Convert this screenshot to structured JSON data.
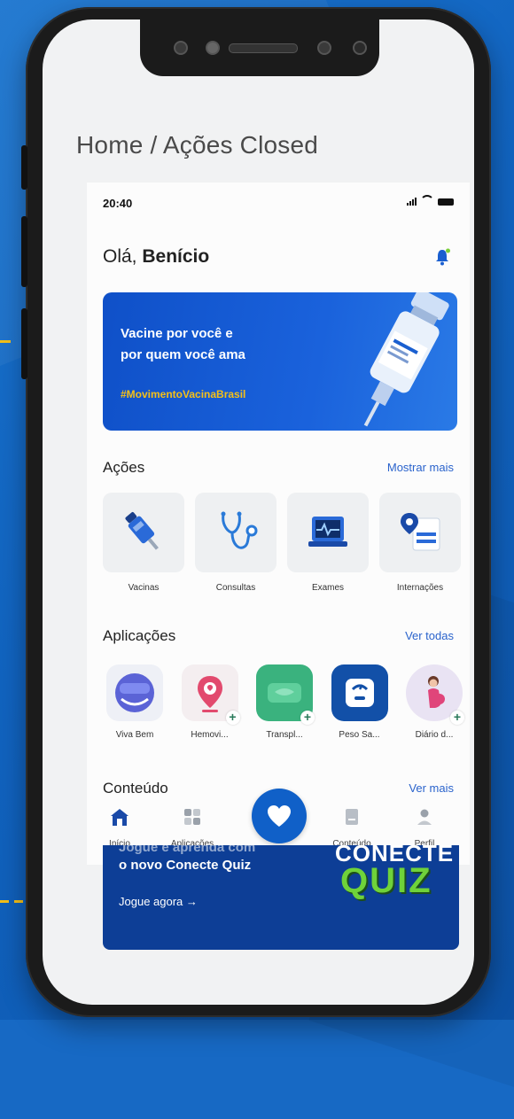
{
  "page_title": "Home / Ações Closed",
  "status": {
    "time": "20:40"
  },
  "greeting": {
    "prefix": "Olá, ",
    "name": "Benício"
  },
  "banner": {
    "line1": "Vacine por você e",
    "line2": "por quem você ama",
    "hashtag": "#MovimentoVacinaBrasil"
  },
  "acoes": {
    "title": "Ações",
    "more": "Mostrar mais",
    "items": [
      {
        "label": "Vacinas",
        "icon": "syringe-icon"
      },
      {
        "label": "Consultas",
        "icon": "stethoscope-icon"
      },
      {
        "label": "Exames",
        "icon": "monitor-icon"
      },
      {
        "label": "Internações",
        "icon": "hospital-card-icon"
      }
    ]
  },
  "aplicacoes": {
    "title": "Aplicações",
    "more": "Ver todas",
    "items": [
      {
        "label": "Viva Bem",
        "icon": "viva-bem-icon"
      },
      {
        "label": "Hemovi...",
        "icon": "blood-drop-pin-icon"
      },
      {
        "label": "Transpl...",
        "icon": "transplant-icon"
      },
      {
        "label": "Peso Sa...",
        "icon": "scale-icon"
      },
      {
        "label": "Diário d...",
        "icon": "pregnant-woman-icon"
      }
    ]
  },
  "conteudo": {
    "title": "Conteúdo",
    "more": "Ver mais"
  },
  "tabbar": {
    "inicio": "Início",
    "aplicacoes": "Aplicações",
    "conteudo": "Conteúdo",
    "perfil": "Perfil"
  },
  "quiz": {
    "line0": "Jogue e aprenda com",
    "line1": "o novo Conecte Quiz",
    "cta": "Jogue agora →",
    "brand_top": "CONECTE",
    "brand_bottom": "QUIZ"
  },
  "colors": {
    "accent": "#1060c8",
    "link": "#2a63cc",
    "highlight": "#f5c018"
  }
}
